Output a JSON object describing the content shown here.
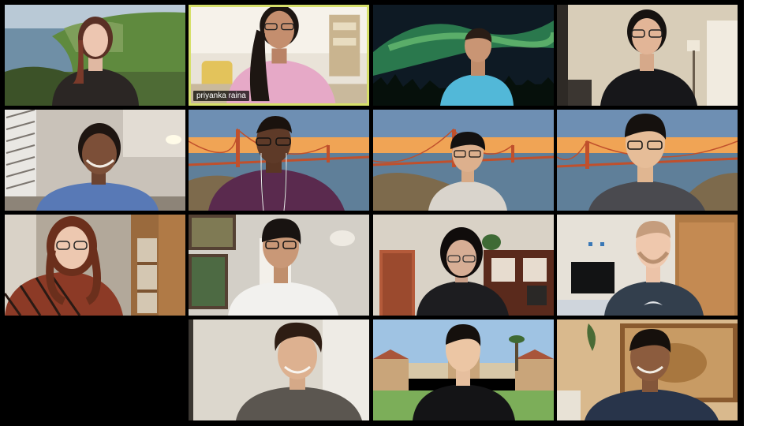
{
  "meeting": {
    "active_speaker": {
      "name": "priyanka raina"
    },
    "participants": [
      {
        "tile": "r0c0",
        "background": "coastal-cliffs"
      },
      {
        "tile": "r0c1",
        "background": "living-room",
        "active": true
      },
      {
        "tile": "r0c2",
        "background": "aurora-borealis"
      },
      {
        "tile": "r0c3",
        "background": "home-office"
      },
      {
        "tile": "r1c0",
        "background": "room-with-window"
      },
      {
        "tile": "r1c1",
        "background": "golden-gate-bridge"
      },
      {
        "tile": "r1c2",
        "background": "golden-gate-bridge"
      },
      {
        "tile": "r1c3",
        "background": "golden-gate-bridge"
      },
      {
        "tile": "r2c0",
        "background": "bookshelf-room"
      },
      {
        "tile": "r2c1",
        "background": "room-with-paintings"
      },
      {
        "tile": "r2c2",
        "background": "dining-room"
      },
      {
        "tile": "r2c3",
        "background": "bedroom"
      },
      {
        "tile": "r3c1",
        "background": "bright-room"
      },
      {
        "tile": "r3c2",
        "background": "stanford-quad"
      },
      {
        "tile": "r3c3",
        "background": "tapestry-wall"
      }
    ]
  },
  "colors": {
    "grid_background": "#000000",
    "active_speaker_border": "#d6e06a",
    "label_text": "#ffffff"
  }
}
